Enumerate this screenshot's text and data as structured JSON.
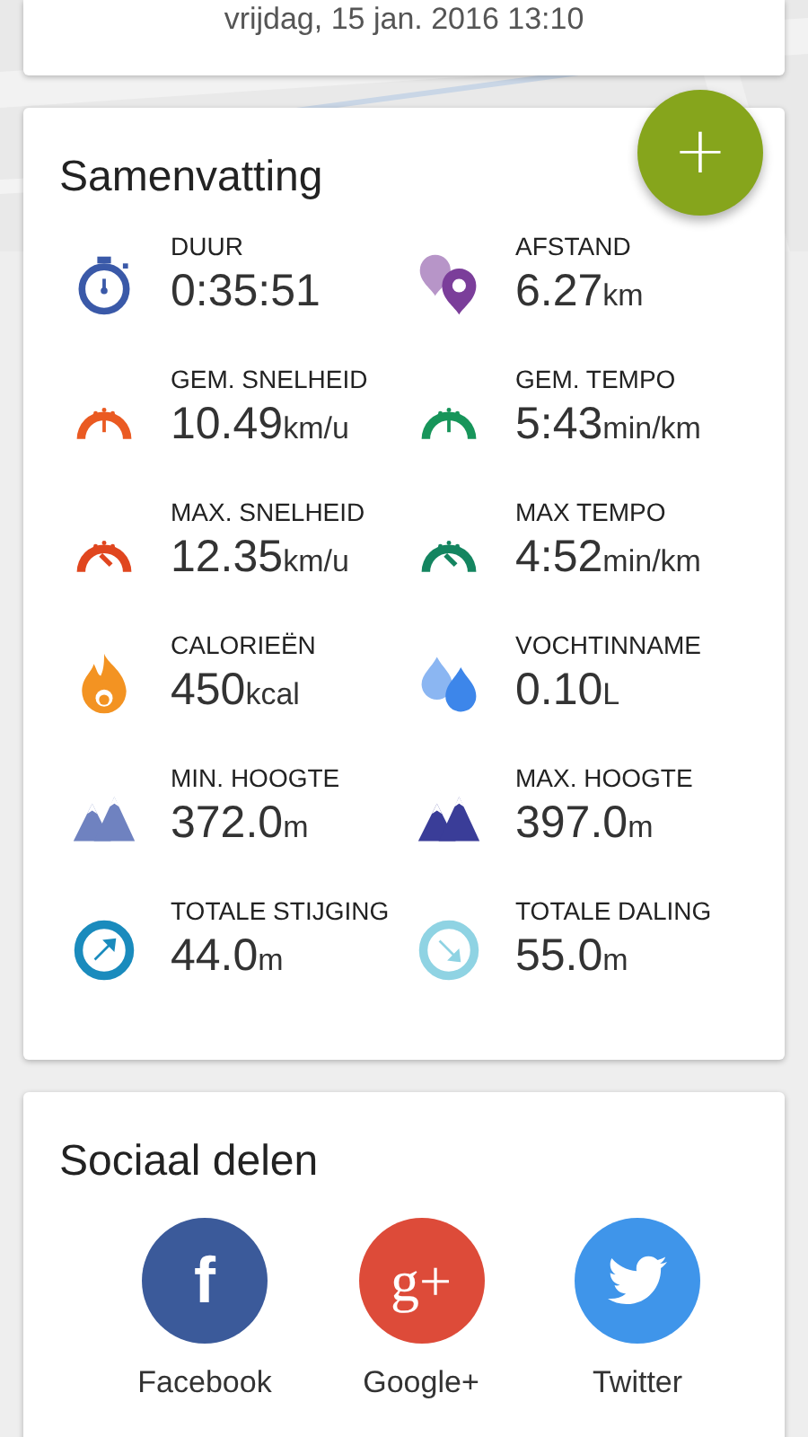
{
  "header_card": {
    "date": "vrijdag, 15 jan. 2016 13:10"
  },
  "fab": {
    "label": "+"
  },
  "summary": {
    "title": "Samenvatting",
    "stats": [
      {
        "kind": "stopwatch",
        "color": "#3a59a8",
        "label": "DUUR",
        "value": "0:35:51"
      },
      {
        "kind": "pins",
        "color": "#7b3e9a",
        "label": "AFSTAND",
        "value": "6.27",
        "unit": "km"
      },
      {
        "kind": "gauge",
        "color": "#ea5a22",
        "label": "GEM. SNELHEID",
        "value": "10.49",
        "unit": "km/u"
      },
      {
        "kind": "gauge",
        "color": "#17955a",
        "label": "GEM. TEMPO",
        "value": "5:43",
        "unit": "min/km"
      },
      {
        "kind": "gauge-high",
        "color": "#e0461f",
        "label": "MAX. SNELHEID",
        "value": "12.35",
        "unit": "km/u"
      },
      {
        "kind": "gauge-high",
        "color": "#148560",
        "label": "MAX TEMPO",
        "value": "4:52",
        "unit": "min/km"
      },
      {
        "kind": "flame",
        "color": "#f39322",
        "label": "CALORIEËN",
        "value": "450",
        "unit": "kcal"
      },
      {
        "kind": "drops",
        "color": "#3d86ea",
        "label": "VOCHTINNAME",
        "value": "0.10",
        "unit": "L"
      },
      {
        "kind": "mountains",
        "color": "#6f82c0",
        "label": "MIN. HOOGTE",
        "value": "372.0",
        "unit": "m"
      },
      {
        "kind": "mountains",
        "color": "#3a3d98",
        "label": "MAX. HOOGTE",
        "value": "397.0",
        "unit": "m"
      },
      {
        "kind": "arrow-up",
        "color": "#1a8bbd",
        "label": "TOTALE STIJGING",
        "value": "44.0",
        "unit": "m"
      },
      {
        "kind": "arrow-down",
        "color": "#8fd3e3",
        "label": "TOTALE DALING",
        "value": "55.0",
        "unit": "m"
      }
    ]
  },
  "social": {
    "title": "Sociaal delen",
    "buttons": [
      {
        "kind": "facebook",
        "color": "#3b5a9a",
        "glyph": "f",
        "label": "Facebook"
      },
      {
        "kind": "googleplus",
        "color": "#dd4b39",
        "glyph": "g+",
        "label": "Google+"
      },
      {
        "kind": "twitter",
        "color": "#3f95ea",
        "label": "Twitter"
      }
    ]
  }
}
